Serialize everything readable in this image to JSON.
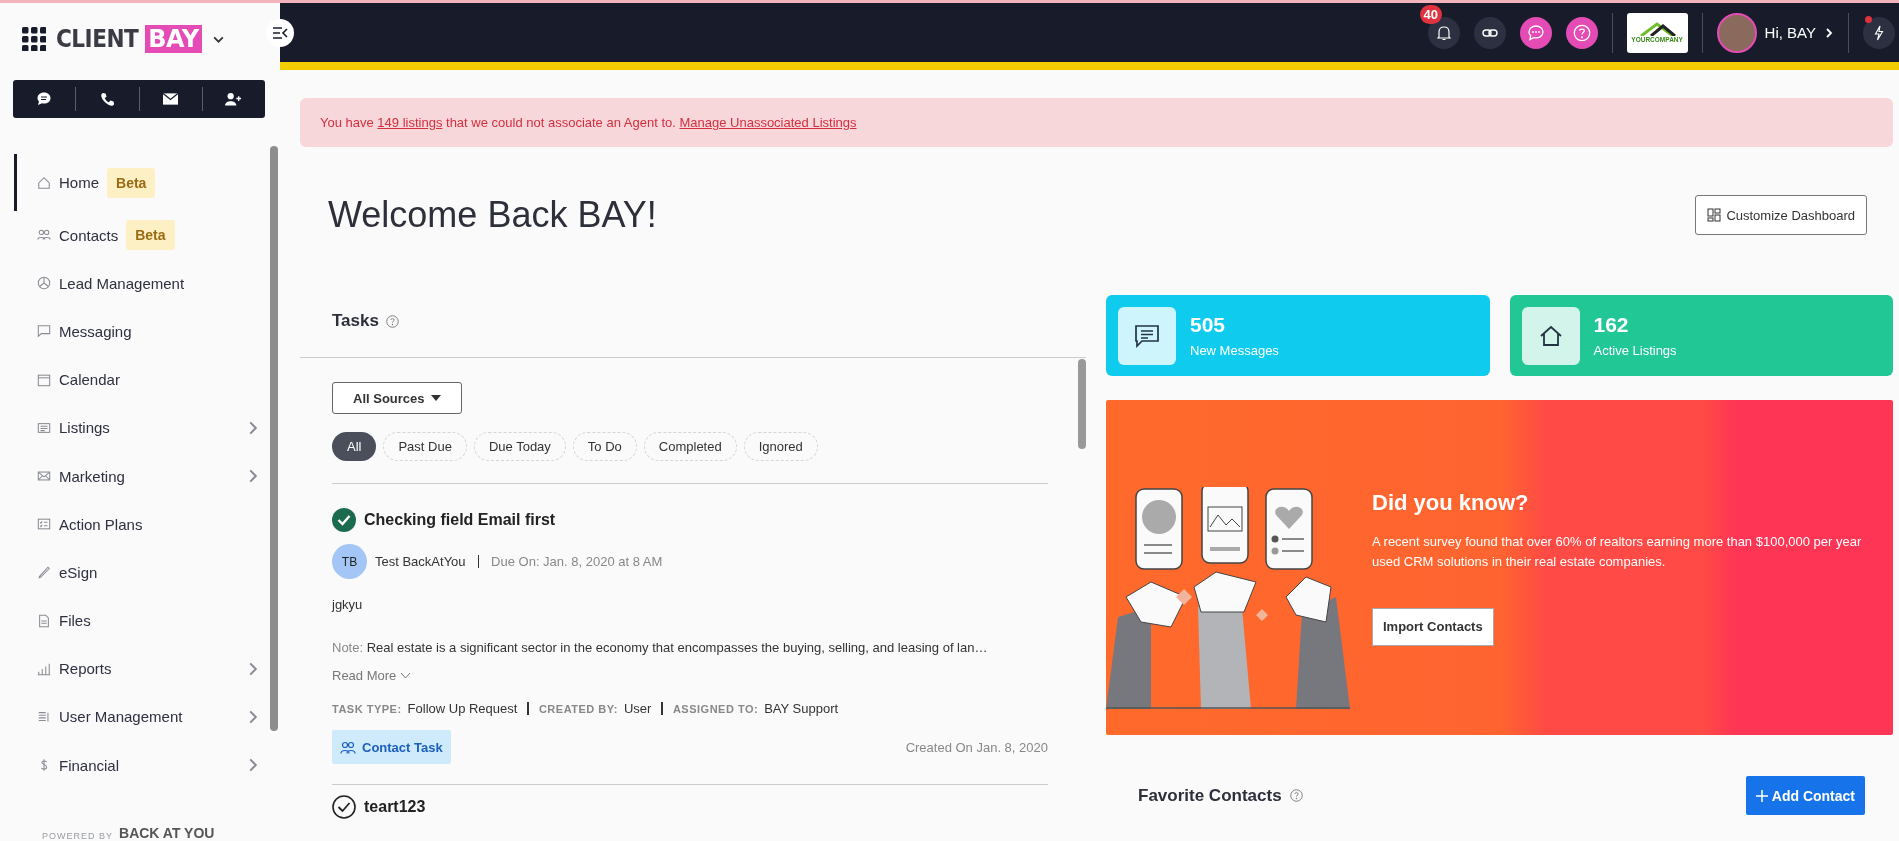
{
  "brand": {
    "name": "CLIENT",
    "badge": "BAY"
  },
  "sidebar": {
    "items": [
      {
        "label": "Home",
        "badge": "Beta",
        "selected": true,
        "has_submenu": false
      },
      {
        "label": "Contacts",
        "badge": "Beta",
        "selected": false,
        "has_submenu": false
      },
      {
        "label": "Lead Management",
        "selected": false,
        "has_submenu": false
      },
      {
        "label": "Messaging",
        "selected": false,
        "has_submenu": false
      },
      {
        "label": "Calendar",
        "selected": false,
        "has_submenu": false
      },
      {
        "label": "Listings",
        "selected": false,
        "has_submenu": true
      },
      {
        "label": "Marketing",
        "selected": false,
        "has_submenu": true
      },
      {
        "label": "Action Plans",
        "selected": false,
        "has_submenu": false
      },
      {
        "label": "eSign",
        "selected": false,
        "has_submenu": false
      },
      {
        "label": "Files",
        "selected": false,
        "has_submenu": false
      },
      {
        "label": "Reports",
        "selected": false,
        "has_submenu": true
      },
      {
        "label": "User Management",
        "selected": false,
        "has_submenu": true
      },
      {
        "label": "Financial",
        "selected": false,
        "has_submenu": true
      }
    ],
    "footer": {
      "powered_by": "POWERED BY",
      "vendor": "BACK AT YOU"
    }
  },
  "topbar": {
    "notification_count": "40",
    "company_logo": "YOURCOMPANY",
    "greeting": "Hi, BAY",
    "flash_alert": true
  },
  "alert": {
    "prefix": "You have ",
    "link": "149 listings",
    "middle": " that we could not associate an Agent to. ",
    "action": "Manage Unassociated Listings"
  },
  "header": {
    "title": "Welcome Back BAY!",
    "customize_button": "Customize Dashboard"
  },
  "tasks": {
    "title": "Tasks",
    "source_filter": "All Sources",
    "filters": [
      {
        "label": "All",
        "selected": true
      },
      {
        "label": "Past Due",
        "selected": false
      },
      {
        "label": "Due Today",
        "selected": false
      },
      {
        "label": "To Do",
        "selected": false
      },
      {
        "label": "Completed",
        "selected": false
      },
      {
        "label": "Ignored",
        "selected": false
      }
    ],
    "items": [
      {
        "title": "Checking field Email first",
        "completed": true,
        "initials": "TB",
        "contact": "Test BackAtYou",
        "due": "Due On: Jan. 8, 2020 at 8 AM",
        "description": "jgkyu",
        "note_label": "Note:",
        "note": "Real estate is a significant sector in the economy that encompasses the buying, selling, and leasing of lan…",
        "read_more": "Read More",
        "meta": [
          {
            "label": "TASK TYPE:",
            "value": "Follow Up Request"
          },
          {
            "label": "CREATED BY:",
            "value": "User"
          },
          {
            "label": "ASSIGNED TO:",
            "value": "BAY Support"
          }
        ],
        "tag": "Contact Task",
        "created": "Created On Jan. 8, 2020"
      },
      {
        "title": "teart123",
        "completed": false
      }
    ]
  },
  "stats": [
    {
      "value": "505",
      "label": "New Messages",
      "color": "#0fcbee"
    },
    {
      "value": "162",
      "label": "Active Listings",
      "color": "#21c795"
    }
  ],
  "promo": {
    "title": "Did you know?",
    "body": "A recent survey found that over 60% of realtors earning more than $100,000 per year used CRM solutions in their real estate companies.",
    "button": "Import Contacts"
  },
  "favorites": {
    "title": "Favorite Contacts",
    "button": "Add Contact"
  }
}
